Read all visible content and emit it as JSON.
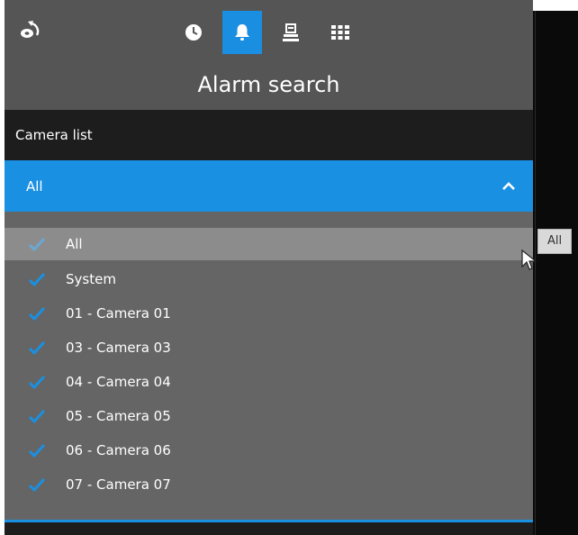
{
  "header": {
    "title": "Alarm search",
    "back_icon": "rotate-back-icon",
    "tools": [
      {
        "icon": "clock-icon",
        "active": false
      },
      {
        "icon": "bell-icon",
        "active": true
      },
      {
        "icon": "export-icon",
        "active": false
      },
      {
        "icon": "grid-icon",
        "active": false
      }
    ]
  },
  "camera_list": {
    "header_label": "Camera list",
    "selected_value": "All",
    "expanded": true,
    "items": [
      {
        "label": "All",
        "checked": true,
        "hover": true
      },
      {
        "label": "System",
        "checked": true
      },
      {
        "label": "01 - Camera 01",
        "checked": true
      },
      {
        "label": "03 - Camera 03",
        "checked": true
      },
      {
        "label": "04 - Camera 04",
        "checked": true
      },
      {
        "label": "05 - Camera 05",
        "checked": true
      },
      {
        "label": "06 - Camera 06",
        "checked": true
      },
      {
        "label": "07 - Camera 07",
        "checked": true
      }
    ]
  },
  "tooltip": {
    "text": "All"
  },
  "colors": {
    "accent": "#1a90e2",
    "panel": "#656565",
    "header_dark": "#1d1d1d"
  }
}
